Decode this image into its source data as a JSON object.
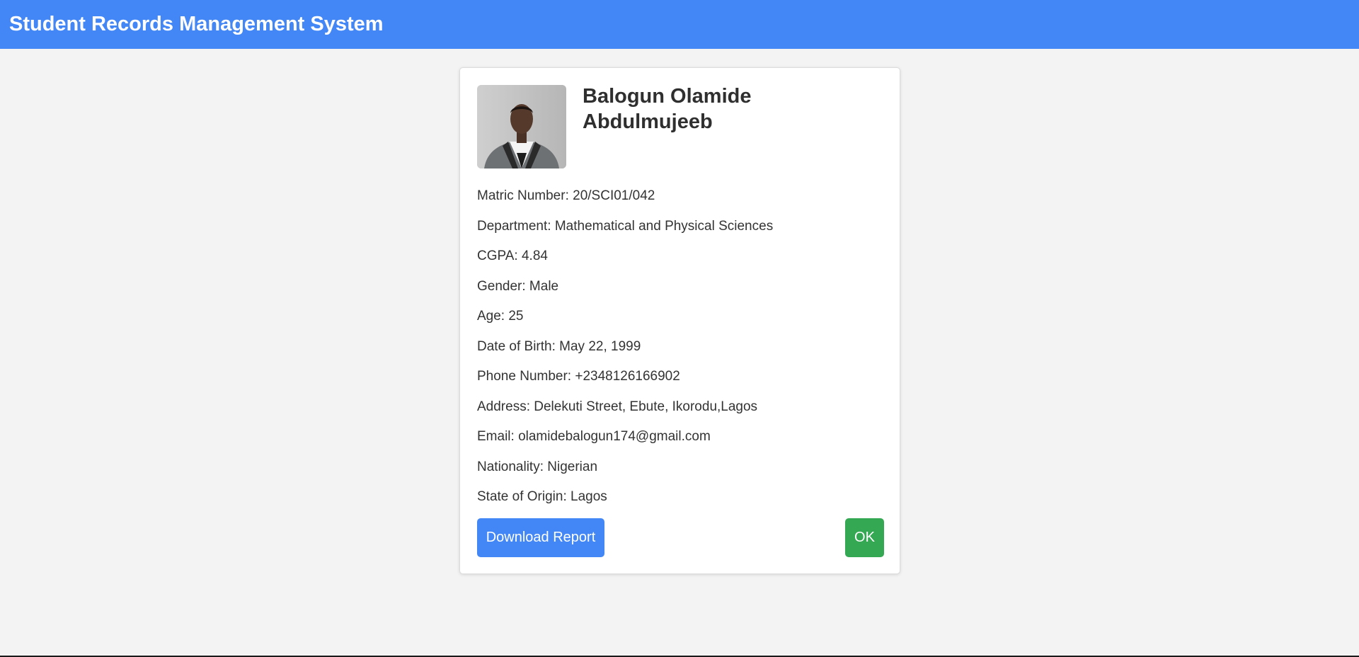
{
  "header": {
    "title": "Student Records Management System"
  },
  "student": {
    "name": "Balogun Olamide Abdulmujeeb",
    "fields": [
      "Matric Number: 20/SCI01/042",
      "Department: Mathematical and Physical Sciences",
      "CGPA: 4.84",
      "Gender: Male",
      "Age: 25",
      "Date of Birth: May 22, 1999",
      "Phone Number: +2348126166902",
      "Address: Delekuti Street, Ebute, Ikorodu,Lagos",
      "Email: olamidebalogun174@gmail.com",
      "Nationality: Nigerian",
      "State of Origin: Lagos"
    ]
  },
  "actions": {
    "download_label": "Download Report",
    "ok_label": "OK"
  },
  "colors": {
    "header_bg": "#4287f5",
    "download_button": "#4287f5",
    "ok_button": "#34a853",
    "page_bg": "#f3f3f3"
  }
}
